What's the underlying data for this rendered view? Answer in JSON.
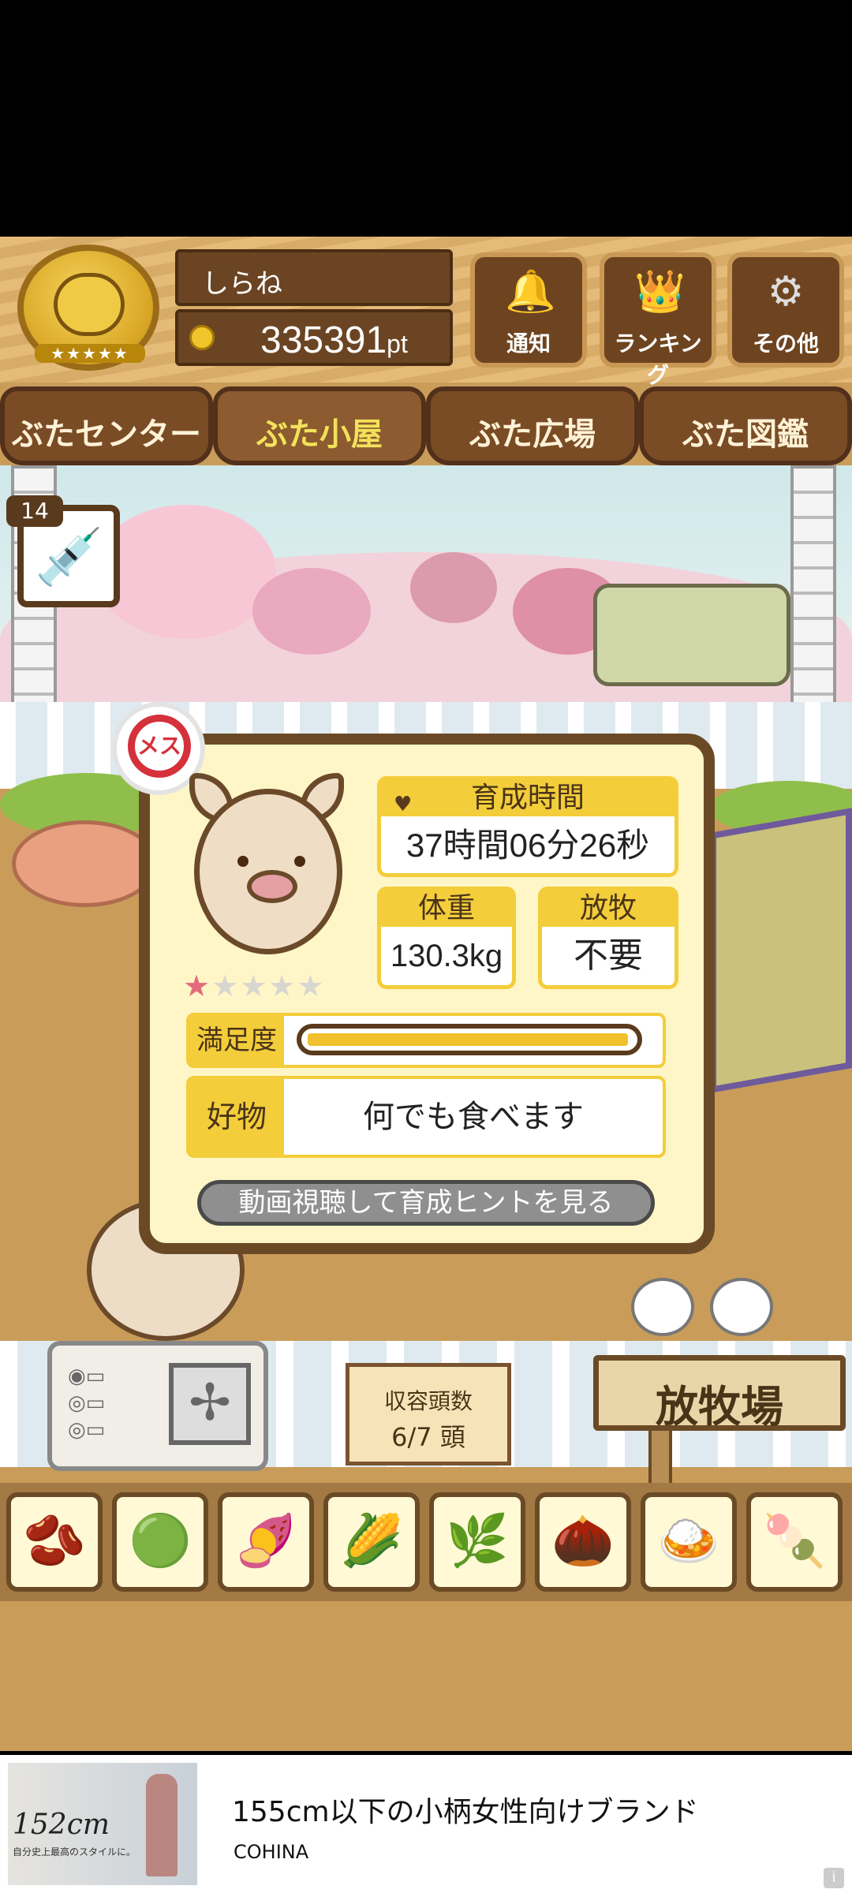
{
  "header": {
    "player_name": "しらね",
    "points": "335391",
    "points_unit": "pt",
    "emblem_stars": "★★★★★"
  },
  "top_buttons": [
    {
      "label": "通知",
      "icon": "bell-icon",
      "glyph": "🔔"
    },
    {
      "label": "ランキング",
      "icon": "crown-icon",
      "glyph": "👑"
    },
    {
      "label": "その他",
      "icon": "gear-icon",
      "glyph": "⚙"
    }
  ],
  "tabs": [
    {
      "label": "ぶたセンター",
      "active": false
    },
    {
      "label": "ぶた小屋",
      "active": true
    },
    {
      "label": "ぶた広場",
      "active": false
    },
    {
      "label": "ぶた図鑑",
      "active": false
    }
  ],
  "item_slot": {
    "count": "14",
    "icon": "syringe-icon",
    "glyph": "💉"
  },
  "pig_info": {
    "gender_label": "メス",
    "rating": 1,
    "rating_max": 5,
    "growth_time_label": "育成時間",
    "growth_time_value": "37時間06分26秒",
    "weight_label": "体重",
    "weight_value": "130.3kg",
    "grazing_label": "放牧",
    "grazing_value": "不要",
    "satisfaction_label": "満足度",
    "satisfaction_level": 0.98,
    "favorite_label": "好物",
    "favorite_value": "何でも食べます",
    "hint_button": "動画視聴して育成ヒントを見る"
  },
  "capacity": {
    "label": "収容頭数",
    "value": "6/7 頭"
  },
  "pasture_sign": "放牧場",
  "foods": [
    {
      "name": "grain-pile-icon",
      "glyph": "🫘"
    },
    {
      "name": "mixed-beans-icon",
      "glyph": "🟢"
    },
    {
      "name": "sweet-potato-icon",
      "glyph": "🍠"
    },
    {
      "name": "corn-icon",
      "glyph": "🌽"
    },
    {
      "name": "herbs-icon",
      "glyph": "🌿"
    },
    {
      "name": "acorn-icon",
      "glyph": "🌰"
    },
    {
      "name": "beans-plate-icon",
      "glyph": "🍛"
    },
    {
      "name": "chestnut-plate-icon",
      "glyph": "🍡"
    }
  ],
  "ad": {
    "title": "155cm以下の小柄女性向けブランド",
    "brand": "COHINA",
    "image_text": "152cm",
    "image_subtext": "自分史上最高のスタイルに。"
  },
  "colors": {
    "accent_yellow": "#f3cd3a",
    "frame_brown": "#6a4a26",
    "gender_red": "#d4313b"
  }
}
